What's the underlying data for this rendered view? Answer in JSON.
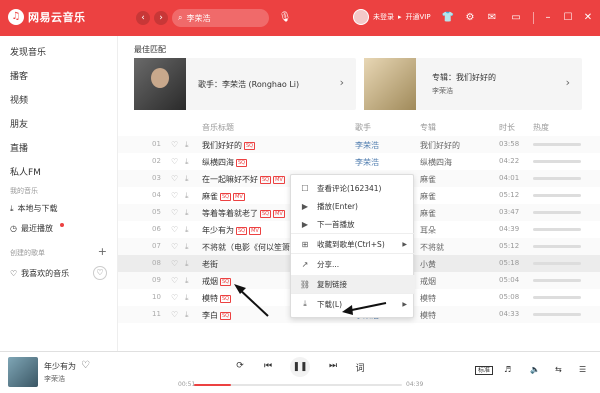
{
  "app": {
    "name": "网易云音乐",
    "logo_glyph": "♫"
  },
  "header": {
    "back": "‹",
    "forward": "›",
    "search_value": "李荣浩",
    "user_label": "未登录",
    "vip_label": "开通VIP",
    "icons": [
      "shirt-icon",
      "settings-icon",
      "mail-icon",
      "minimize-icon",
      "maximize-icon",
      "close-icon"
    ]
  },
  "sidebar": {
    "items": [
      "发现音乐",
      "播客",
      "视频",
      "朋友",
      "直播",
      "私人FM"
    ],
    "my_music_header": "我的音乐",
    "my_music": [
      "本地与下载",
      "最近播放"
    ],
    "created_header": "创建的歌单",
    "created_playlists": [
      "我喜欢的音乐"
    ]
  },
  "main": {
    "best_match_title": "最佳匹配",
    "artist_card": {
      "label": "歌手：李荣浩 (Ronghao Li)"
    },
    "album_card": {
      "label": "专辑：我们好好的",
      "artist": "李荣浩"
    },
    "columns": {
      "title": "音乐标题",
      "artist": "歌手",
      "album": "专辑",
      "duration": "时长",
      "heat": "热度"
    },
    "songs": [
      {
        "num": "01",
        "title": "我们好好的",
        "tags": [
          "SQ"
        ],
        "artist": "李荣浩",
        "album": "我们好好的",
        "duration": "03:58"
      },
      {
        "num": "02",
        "title": "纵横四海",
        "tags": [
          "SQ"
        ],
        "artist": "李荣浩",
        "album": "纵横四海",
        "duration": "04:22"
      },
      {
        "num": "03",
        "title": "在一起嘛好不好",
        "tags": [
          "SQ",
          "MV"
        ],
        "artist": "李荣浩",
        "album": "麻雀",
        "duration": "04:01"
      },
      {
        "num": "04",
        "title": "麻雀",
        "tags": [
          "SQ",
          "MV"
        ],
        "artist": "李荣浩",
        "album": "麻雀",
        "duration": "05:12"
      },
      {
        "num": "05",
        "title": "等着等着就老了",
        "tags": [
          "SQ",
          "MV"
        ],
        "artist": "李荣浩",
        "album": "麻雀",
        "duration": "03:47"
      },
      {
        "num": "06",
        "title": "年少有为",
        "tags": [
          "SQ",
          "MV"
        ],
        "artist": "李荣浩",
        "album": "耳朵",
        "duration": "04:39"
      },
      {
        "num": "07",
        "title": "不将就（电影《何以笙箫默》）",
        "tags": [],
        "artist": "李荣浩",
        "album": "不将就",
        "duration": "05:12"
      },
      {
        "num": "08",
        "title": "老街",
        "tags": [],
        "artist": "李荣浩",
        "album": "小黄",
        "duration": "05:18"
      },
      {
        "num": "09",
        "title": "戒烟",
        "tags": [
          "SQ"
        ],
        "artist": "李荣浩",
        "album": "戒烟",
        "duration": "05:04"
      },
      {
        "num": "10",
        "title": "模特",
        "tags": [
          "SQ"
        ],
        "artist": "李荣浩",
        "album": "模特",
        "duration": "05:08"
      },
      {
        "num": "11",
        "title": "李白",
        "tags": [
          "SQ"
        ],
        "artist": "李荣浩",
        "album": "模特",
        "duration": "04:33"
      }
    ]
  },
  "context_menu": {
    "items": [
      {
        "icon": "comment-icon",
        "glyph": "☐",
        "label": "查看评论(162341)",
        "submenu": false
      },
      {
        "icon": "play-circle-icon",
        "glyph": "▶",
        "label": "播放(Enter)",
        "submenu": false
      },
      {
        "icon": "next-play-icon",
        "glyph": "▶",
        "label": "下一首播放",
        "submenu": false
      },
      {
        "icon": "collect-icon",
        "glyph": "⊞",
        "label": "收藏到歌单(Ctrl+S)",
        "submenu": true
      },
      {
        "icon": "share-icon",
        "glyph": "↗",
        "label": "分享...",
        "submenu": false
      },
      {
        "icon": "link-icon",
        "glyph": "⛓",
        "label": "复制链接",
        "submenu": false
      },
      {
        "icon": "download-icon",
        "glyph": "⤓",
        "label": "下载(L)",
        "submenu": true
      }
    ]
  },
  "player": {
    "title": "年少有为",
    "artist": "李荣浩",
    "elapsed": "00:51",
    "total": "04:39",
    "progress": 0.18,
    "lyric_btn": "词",
    "quality": "标准"
  },
  "colors": {
    "accent": "#ec4141",
    "link": "#507daf"
  }
}
